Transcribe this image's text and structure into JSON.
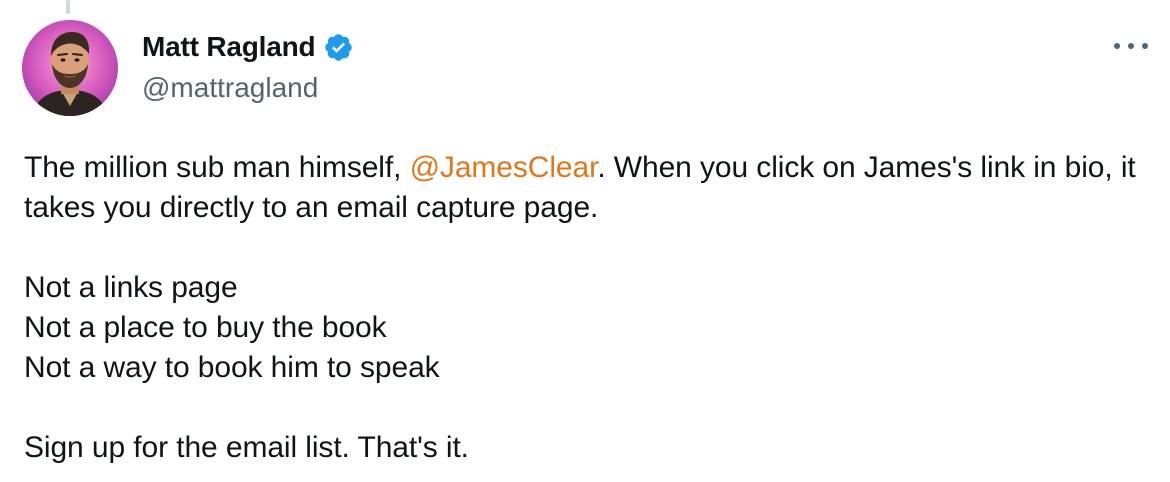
{
  "author": {
    "display_name": "Matt Ragland",
    "handle": "@mattragland",
    "verified": true
  },
  "menu": {
    "icon": "more-horizontal-icon"
  },
  "tweet": {
    "line1_before": "The million sub man himself, ",
    "mention": "@JamesClear",
    "line1_after": ". When you click on James's link in bio, it takes you directly to an email capture page.",
    "list": [
      "Not a links page",
      "Not a place to buy the book",
      "Not a way to book him to speak"
    ],
    "closing": "Sign up for the email list. That's it."
  },
  "colors": {
    "mention": "#e0781b",
    "verified_badge": "#1d9bf0",
    "secondary_text": "#536471"
  }
}
